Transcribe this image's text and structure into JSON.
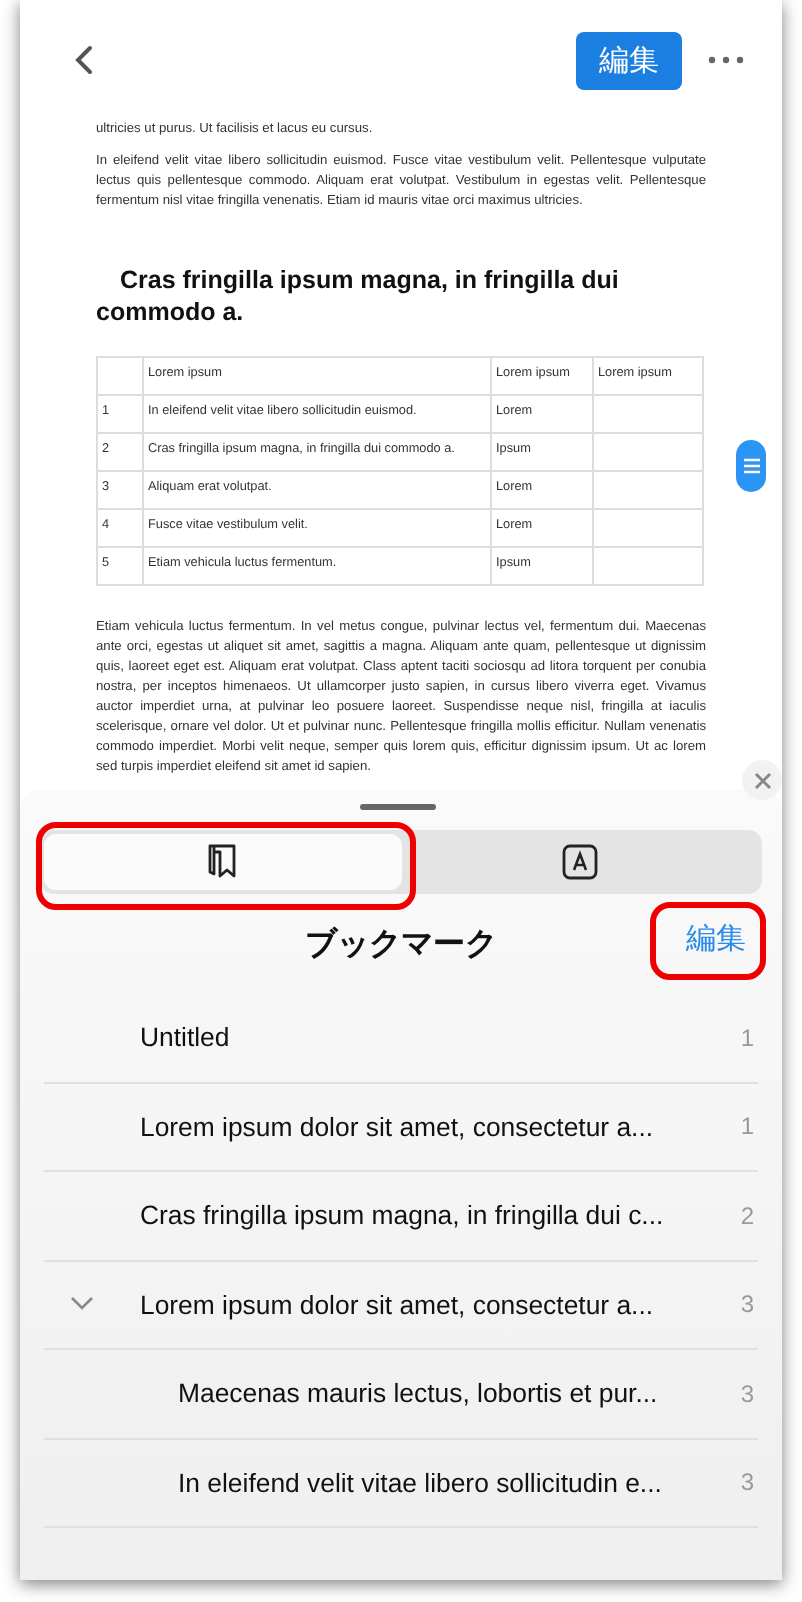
{
  "header": {
    "edit_button": "編集"
  },
  "document": {
    "paragraphs_top": [
      "ultricies ut purus. Ut facilisis et lacus eu cursus.",
      "In eleifend velit vitae libero sollicitudin euismod. Fusce vitae vestibulum velit. Pellentesque vulputate lectus quis pellentesque commodo. Aliquam erat volutpat. Vestibulum in egestas velit. Pellentesque fermentum nisl vitae fringilla venenatis. Etiam id mauris vitae orci maximus ultricies."
    ],
    "heading": "Cras fringilla ipsum magna, in fringilla dui commodo a.",
    "table": {
      "columns": [
        "",
        "Lorem ipsum",
        "Lorem ipsum",
        "Lorem ipsum"
      ],
      "rows": [
        [
          "1",
          "In eleifend velit vitae libero sollicitudin euismod.",
          "Lorem",
          ""
        ],
        [
          "2",
          "Cras fringilla ipsum magna, in fringilla dui commodo a.",
          "Ipsum",
          ""
        ],
        [
          "3",
          "Aliquam erat volutpat.",
          "Lorem",
          ""
        ],
        [
          "4",
          "Fusce vitae vestibulum velit.",
          "Lorem",
          ""
        ],
        [
          "5",
          "Etiam vehicula luctus fermentum.",
          "Ipsum",
          ""
        ]
      ]
    },
    "paragraph_bottom": "Etiam vehicula luctus fermentum. In vel metus congue, pulvinar lectus vel, fermentum dui. Maecenas ante orci, egestas ut aliquet sit amet, sagittis a magna. Aliquam ante quam, pellentesque ut dignissim quis, laoreet eget est. Aliquam erat volutpat. Class aptent taciti sociosqu ad litora torquent per conubia nostra, per inceptos himenaeos. Ut ullamcorper justo sapien, in cursus libero viverra eget. Vivamus auctor imperdiet urna, at pulvinar leo posuere laoreet. Suspendisse neque nisl, fringilla at iaculis scelerisque, ornare vel dolor. Ut et pulvinar nunc. Pellentesque fringilla mollis efficitur. Nullam venenatis commodo imperdiet. Morbi velit neque, semper quis lorem quis, efficitur dignissim ipsum. Ut ac lorem sed turpis imperdiet eleifend sit amet id sapien."
  },
  "sheet": {
    "tabs": [
      {
        "kind": "bookmarks",
        "selected": true
      },
      {
        "kind": "annotations",
        "selected": false
      }
    ],
    "title": "ブックマーク",
    "edit_button": "編集",
    "bookmarks": [
      {
        "title": "Untitled",
        "page": "1"
      },
      {
        "title": "Lorem ipsum dolor sit amet, consectetur a...",
        "page": "1"
      },
      {
        "title": "Cras fringilla ipsum magna, in fringilla dui c...",
        "page": "2"
      },
      {
        "title": "Lorem ipsum dolor sit amet, consectetur a...",
        "page": "3",
        "expanded": true,
        "children": [
          {
            "title": "Maecenas mauris lectus, lobortis et pur...",
            "page": "3"
          },
          {
            "title": "In eleifend velit vitae libero sollicitudin e...",
            "page": "3"
          }
        ]
      }
    ]
  }
}
